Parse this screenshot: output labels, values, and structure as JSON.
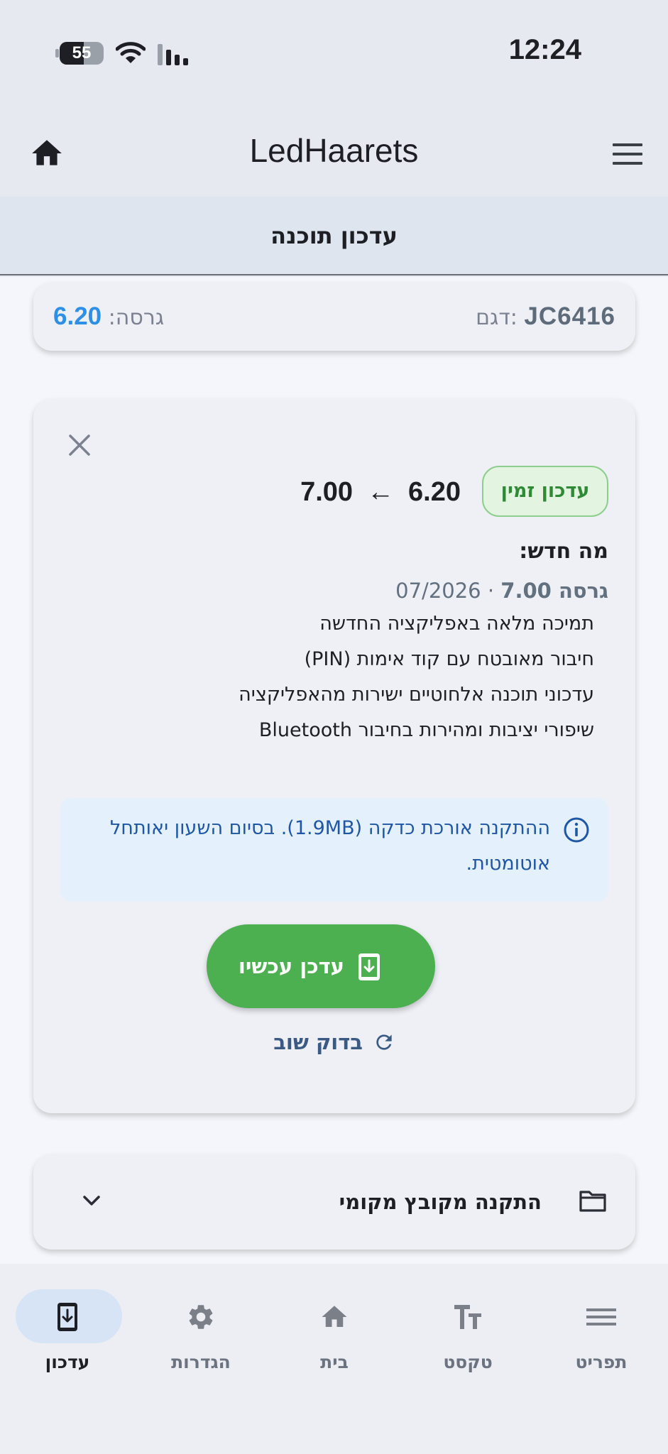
{
  "status_bar": {
    "time": "12:24",
    "battery": "55",
    "battery_level": 0.55
  },
  "app_bar": {
    "title": "LedHaarets",
    "home_icon": "home-icon",
    "menu_icon": "hamburger-menu-icon"
  },
  "subheader": {
    "title": "עדכון תוכנה"
  },
  "device_card": {
    "model_label": "דגם:",
    "model_value": "JC6416",
    "firmware_label": "גרסה:",
    "firmware_value": "6.20"
  },
  "update_card": {
    "badge": "עדכון זמין",
    "current_version": "6.20",
    "new_version": "7.00",
    "arrow": "←",
    "whats_new_title": "מה חדש:",
    "version_prefix": "גרסה 7.00",
    "version_date": "· 07/2026",
    "notes": [
      "תמיכה מלאה באפליקציה החדשה",
      "חיבור מאובטח עם קוד אימות (PIN)",
      "עדכוני תוכנה אלחוטיים ישירות מהאפליקציה",
      "שיפורי יציבות ומהירות בחיבור Bluetooth"
    ],
    "info_text": "ההתקנה אורכת כדקה (1.9MB). בסיום השעון יאותחל אוטומטית.",
    "update_button": "עדכן עכשיו",
    "recheck_button": "בדוק שוב"
  },
  "local_install": {
    "label": "התקנה מקובץ מקומי"
  },
  "bottom_nav": {
    "items": [
      {
        "label": "תפריט",
        "icon": "menu-icon"
      },
      {
        "label": "טקסט",
        "icon": "text-size-icon"
      },
      {
        "label": "בית",
        "icon": "home-icon"
      },
      {
        "label": "הגדרות",
        "icon": "gear-icon"
      },
      {
        "label": "עדכון",
        "icon": "update-phone-icon",
        "active": true
      }
    ]
  },
  "colors": {
    "accent_blue": "#2e8fe6",
    "update_green": "#4caf50",
    "info_text": "#1f57a6",
    "badge_green": "#2f8a36"
  }
}
